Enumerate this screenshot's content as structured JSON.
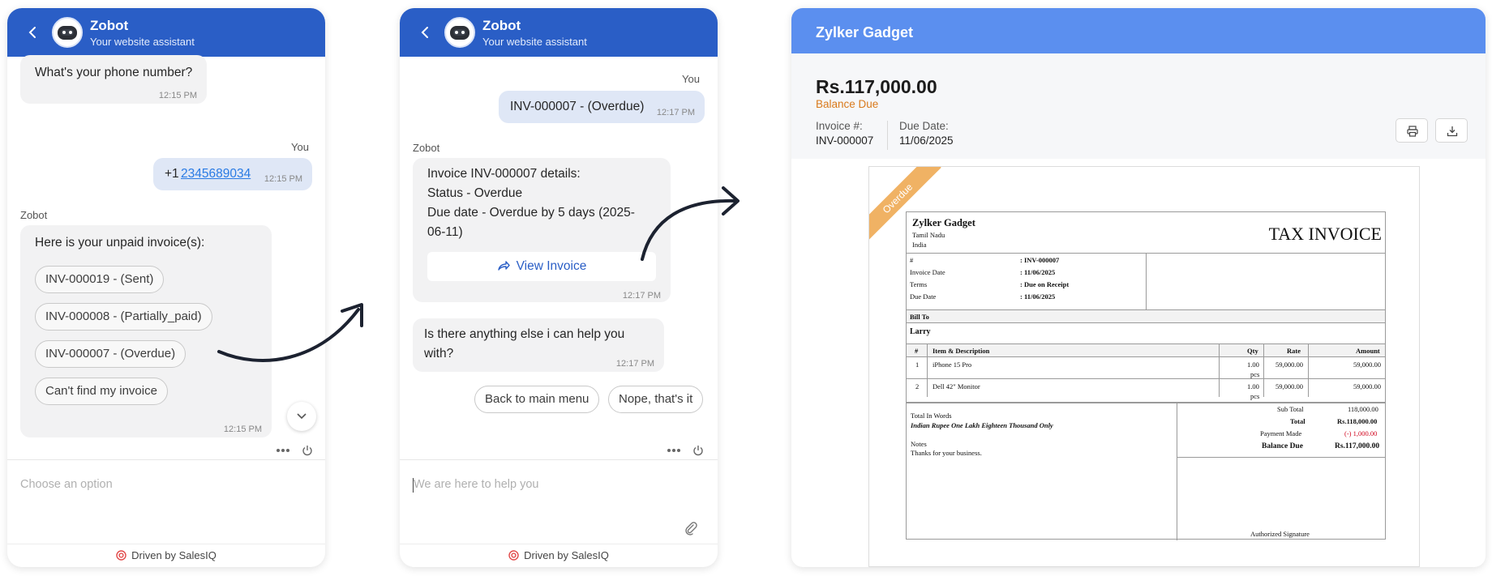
{
  "chat1": {
    "bot_name": "Zobot",
    "bot_subtitle": "Your website assistant",
    "msg_phone_q": "What's your phone number?",
    "msg_phone_q_time": "12:15 PM",
    "you_label": "You",
    "phone_prefix": "+1",
    "phone_number": "2345689034",
    "phone_time": "12:15 PM",
    "bot_label": "Zobot",
    "unpaid_text": "Here is your unpaid invoice(s):",
    "options": [
      "INV-000019 - (Sent)",
      "INV-000008 - (Partially_paid)",
      "INV-000007 - (Overdue)",
      "Can't find my invoice"
    ],
    "options_time": "12:15 PM",
    "composer_placeholder": "Choose an option",
    "footer": "Driven by SalesIQ"
  },
  "chat2": {
    "bot_name": "Zobot",
    "bot_subtitle": "Your website assistant",
    "you_label": "You",
    "selected_invoice": "INV-000007 - (Overdue)",
    "selected_time": "12:17 PM",
    "bot_label": "Zobot",
    "details_lines": [
      "Invoice INV-000007 details:",
      "Status - Overdue",
      "Due date - Overdue by 5 days (2025-",
      "06-11)"
    ],
    "view_invoice": "View Invoice",
    "details_time": "12:17 PM",
    "help_lines": [
      "Is there anything else i can help you",
      "with?"
    ],
    "help_time": "12:17 PM",
    "quick_replies": [
      "Back to main menu",
      "Nope, that's it"
    ],
    "composer_placeholder": "We are here to help you",
    "footer": "Driven by SalesIQ"
  },
  "invoice": {
    "company": "Zylker Gadget",
    "amount": "Rs.117,000.00",
    "balance_label": "Balance Due",
    "invoice_no_label": "Invoice #:",
    "invoice_no": "INV-000007",
    "due_date_label": "Due Date:",
    "due_date": "11/06/2025",
    "ribbon": "Overdue",
    "doc": {
      "company": "Zylker Gadget",
      "address1": "Tamil Nadu",
      "address2": "India",
      "title": "TAX INVOICE",
      "fields": [
        {
          "label": "#",
          "value": ": INV-000007"
        },
        {
          "label": "Invoice Date",
          "value": ": 11/06/2025"
        },
        {
          "label": "Terms",
          "value": ": Due on Receipt"
        },
        {
          "label": "Due Date",
          "value": ": 11/06/2025"
        }
      ],
      "bill_to_label": "Bill To",
      "bill_to": "Larry",
      "columns": [
        "#",
        "Item & Description",
        "Qty",
        "Rate",
        "Amount"
      ],
      "items": [
        {
          "n": "1",
          "desc": "iPhone 15 Pro",
          "qty": "1.00",
          "unit": "pcs",
          "rate": "59,000.00",
          "amount": "59,000.00"
        },
        {
          "n": "2",
          "desc": "Dell 42\" Monitor",
          "qty": "1.00",
          "unit": "pcs",
          "rate": "59,000.00",
          "amount": "59,000.00"
        }
      ],
      "words_label": "Total In Words",
      "words": "Indian Rupee One Lakh Eighteen Thousand Only",
      "notes_label": "Notes",
      "notes": "Thanks for your business.",
      "sub_total_label": "Sub Total",
      "sub_total": "118,000.00",
      "total_label": "Total",
      "total": "Rs.118,000.00",
      "payment_label": "Payment Made",
      "payment": "(-) 1,000.00",
      "balance_label": "Balance Due",
      "balance": "Rs.117,000.00",
      "signature": "Authorized Signature"
    }
  },
  "colors": {
    "header_blue": "#2a5ec6",
    "invoice_blue": "#5b8fef",
    "balance_orange": "#d97a1b",
    "ribbon": "#f0b264",
    "payment_red": "#d0021b"
  }
}
